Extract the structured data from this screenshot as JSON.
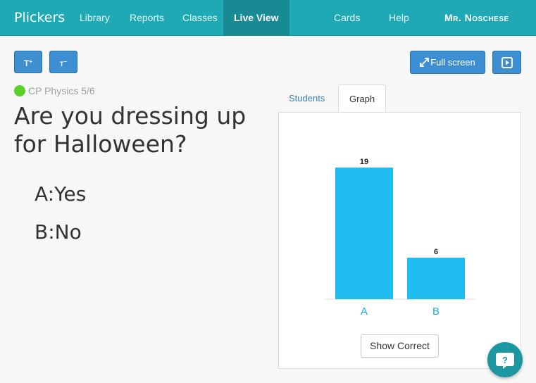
{
  "nav": {
    "brand": "Plickers",
    "items": [
      "Library",
      "Reports",
      "Classes",
      "Live View"
    ],
    "right": [
      "Cards",
      "Help",
      "Mr. Noschese"
    ]
  },
  "toolbar": {
    "increase_text_label": "T",
    "decrease_text_label": "T",
    "fullscreen_label": "Full screen",
    "accent_color": "#3d8fd1"
  },
  "class_name": "CP Physics 5/6",
  "question": "Are you dressing up for Halloween?",
  "choices": [
    {
      "letter": "A:",
      "text": "Yes"
    },
    {
      "letter": "B:",
      "text": "No"
    }
  ],
  "tabs": [
    "Students",
    "Graph"
  ],
  "show_correct_label": "Show Correct",
  "chart_data": {
    "type": "bar",
    "categories": [
      "A",
      "B"
    ],
    "values": [
      19,
      6
    ],
    "bar_color": "#1fbcf0",
    "label_color": "#1fa8e0"
  }
}
